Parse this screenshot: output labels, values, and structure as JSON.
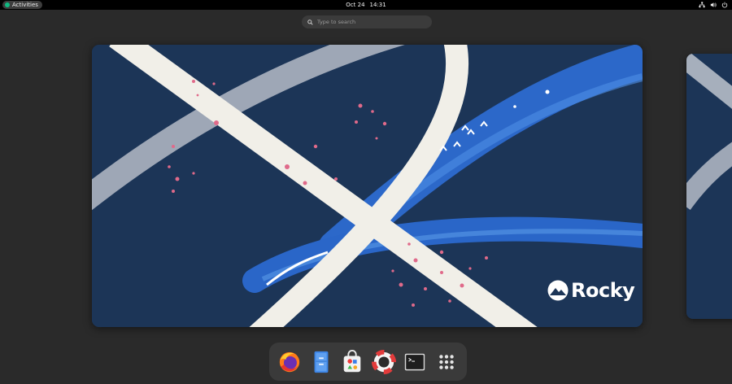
{
  "topbar": {
    "activities_label": "Activities",
    "date": "Oct 24",
    "time": "14:31",
    "tray_icons": [
      "network-icon",
      "volume-icon",
      "power-icon"
    ]
  },
  "search": {
    "placeholder": "Type to search"
  },
  "workspace": {
    "wallpaper_brand": "Rocky",
    "colors": {
      "background": "#1c3557",
      "stripe": "#f1efe8",
      "accent": "#2f6fd6",
      "splatter": "#e06a8a"
    }
  },
  "dash": {
    "apps": [
      {
        "name": "Firefox",
        "icon": "firefox-icon"
      },
      {
        "name": "Files",
        "icon": "files-icon"
      },
      {
        "name": "Software",
        "icon": "software-icon"
      },
      {
        "name": "Help",
        "icon": "help-icon"
      },
      {
        "name": "Terminal",
        "icon": "terminal-icon"
      },
      {
        "name": "Show Applications",
        "icon": "app-grid-icon"
      }
    ]
  }
}
